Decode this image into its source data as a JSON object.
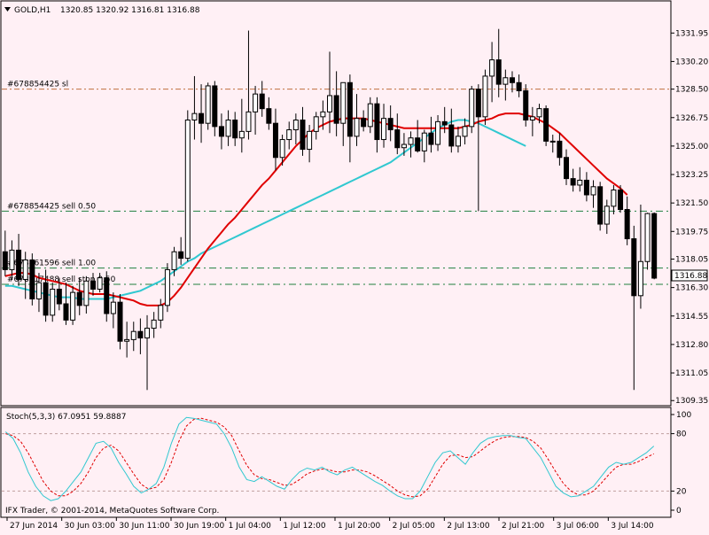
{
  "window": {
    "symbol_label": "GOLD,H1",
    "ohlc_label": "1320.85 1320.92 1316.81 1316.88",
    "copyright": "IFX Trader, © 2001-2014, MetaQuotes Software Corp."
  },
  "colors": {
    "background": "#fff0f5",
    "bull_body": "#ffffff",
    "bear_body": "#000000",
    "ma_fast": "#e00000",
    "ma_slow": "#30c8d0",
    "sl_line": "#c07040",
    "order_line": "#208040",
    "stoch_main": "#30c8d0",
    "stoch_signal": "#e00000",
    "stoch_level": "#c0a0a0"
  },
  "chart_data": [
    {
      "type": "candlestick",
      "title": "GOLD,H1",
      "ylim": [
        1309.2,
        1333.0
      ],
      "y_ticks": [
        "1331.95",
        "1330.20",
        "1328.50",
        "1326.75",
        "1325.00",
        "1323.25",
        "1321.50",
        "1319.75",
        "1318.05",
        "1316.30",
        "1314.55",
        "1312.80",
        "1311.05",
        "1309.35"
      ],
      "x_ticks": [
        "27 Jun 2014",
        "30 Jun 03:00",
        "30 Jun 11:00",
        "30 Jun 19:00",
        "1 Jul 04:00",
        "1 Jul 12:00",
        "1 Jul 20:00",
        "2 Jul 05:00",
        "2 Jul 13:00",
        "2 Jul 21:00",
        "3 Jul 06:00",
        "3 Jul 14:00"
      ],
      "current_price": "1316.88",
      "ohlc": [
        [
          1318.5,
          1319.8,
          1317.0,
          1317.4
        ],
        [
          1317.4,
          1319.2,
          1316.8,
          1318.6
        ],
        [
          1318.6,
          1319.6,
          1316.4,
          1316.8
        ],
        [
          1316.8,
          1318.5,
          1315.6,
          1318.0
        ],
        [
          1318.0,
          1318.4,
          1315.2,
          1315.6
        ],
        [
          1315.6,
          1317.2,
          1314.8,
          1316.6
        ],
        [
          1316.6,
          1317.4,
          1314.2,
          1314.6
        ],
        [
          1314.6,
          1316.6,
          1314.2,
          1316.2
        ],
        [
          1316.2,
          1316.9,
          1314.9,
          1315.3
        ],
        [
          1315.3,
          1316.6,
          1314.0,
          1314.3
        ],
        [
          1314.3,
          1316.4,
          1314.0,
          1316.0
        ],
        [
          1316.0,
          1316.9,
          1314.6,
          1315.2
        ],
        [
          1315.2,
          1317.0,
          1314.7,
          1316.7
        ],
        [
          1316.7,
          1317.2,
          1315.8,
          1316.2
        ],
        [
          1316.2,
          1317.2,
          1316.0,
          1316.9
        ],
        [
          1316.9,
          1317.3,
          1314.2,
          1314.7
        ],
        [
          1314.7,
          1316.0,
          1313.8,
          1315.4
        ],
        [
          1315.4,
          1315.9,
          1312.5,
          1313.0
        ],
        [
          1313.0,
          1314.2,
          1312.0,
          1313.1
        ],
        [
          1313.1,
          1314.2,
          1312.4,
          1313.6
        ],
        [
          1313.6,
          1314.4,
          1312.2,
          1313.2
        ],
        [
          1313.2,
          1314.6,
          1310.0,
          1313.8
        ],
        [
          1313.8,
          1314.8,
          1313.2,
          1314.3
        ],
        [
          1314.3,
          1315.6,
          1313.8,
          1315.2
        ],
        [
          1315.2,
          1317.8,
          1314.8,
          1317.4
        ],
        [
          1317.4,
          1318.8,
          1317.0,
          1318.5
        ],
        [
          1318.5,
          1319.4,
          1317.7,
          1318.1
        ],
        [
          1318.1,
          1327.2,
          1317.9,
          1326.6
        ],
        [
          1326.6,
          1329.3,
          1325.4,
          1327.0
        ],
        [
          1327.0,
          1328.8,
          1325.2,
          1326.4
        ],
        [
          1326.4,
          1328.9,
          1326.0,
          1328.7
        ],
        [
          1328.7,
          1329.0,
          1325.6,
          1326.2
        ],
        [
          1326.2,
          1327.0,
          1324.8,
          1325.6
        ],
        [
          1325.6,
          1327.2,
          1325.0,
          1326.6
        ],
        [
          1326.6,
          1327.1,
          1325.0,
          1325.5
        ],
        [
          1325.5,
          1327.9,
          1324.6,
          1325.9
        ],
        [
          1325.9,
          1332.1,
          1325.4,
          1327.1
        ],
        [
          1327.1,
          1328.7,
          1325.7,
          1328.2
        ],
        [
          1328.2,
          1329.0,
          1326.8,
          1327.3
        ],
        [
          1327.3,
          1328.0,
          1326.0,
          1326.4
        ],
        [
          1326.4,
          1327.3,
          1323.5,
          1324.3
        ],
        [
          1324.3,
          1325.7,
          1323.8,
          1325.4
        ],
        [
          1325.4,
          1326.5,
          1324.8,
          1326.0
        ],
        [
          1326.0,
          1327.0,
          1325.1,
          1326.6
        ],
        [
          1326.6,
          1327.4,
          1324.4,
          1324.8
        ],
        [
          1324.8,
          1326.3,
          1324.0,
          1325.9
        ],
        [
          1325.9,
          1327.1,
          1325.4,
          1326.8
        ],
        [
          1326.8,
          1327.8,
          1326.0,
          1327.1
        ],
        [
          1327.1,
          1330.8,
          1325.8,
          1328.1
        ],
        [
          1328.1,
          1329.6,
          1325.6,
          1326.4
        ],
        [
          1326.4,
          1328.8,
          1325.0,
          1328.9
        ],
        [
          1328.9,
          1329.4,
          1324.0,
          1325.6
        ],
        [
          1325.6,
          1328.2,
          1325.0,
          1326.7
        ],
        [
          1326.7,
          1327.2,
          1325.9,
          1326.2
        ],
        [
          1326.2,
          1328.0,
          1325.8,
          1327.6
        ],
        [
          1327.6,
          1328.0,
          1324.6,
          1325.4
        ],
        [
          1325.4,
          1327.6,
          1324.9,
          1326.7
        ],
        [
          1326.7,
          1327.5,
          1325.3,
          1326.0
        ],
        [
          1326.0,
          1327.0,
          1324.5,
          1324.9
        ],
        [
          1324.9,
          1325.8,
          1324.4,
          1325.1
        ],
        [
          1325.1,
          1325.9,
          1324.3,
          1325.5
        ],
        [
          1325.5,
          1326.6,
          1324.6,
          1324.7
        ],
        [
          1324.7,
          1326.0,
          1324.0,
          1325.8
        ],
        [
          1325.8,
          1326.8,
          1324.6,
          1325.1
        ],
        [
          1325.1,
          1326.9,
          1324.7,
          1326.5
        ],
        [
          1326.5,
          1327.4,
          1325.8,
          1326.3
        ],
        [
          1326.3,
          1327.3,
          1324.6,
          1325.0
        ],
        [
          1325.0,
          1326.2,
          1324.6,
          1325.6
        ],
        [
          1325.6,
          1326.7,
          1325.1,
          1326.2
        ],
        [
          1326.2,
          1328.7,
          1325.8,
          1328.5
        ],
        [
          1328.5,
          1328.8,
          1321.0,
          1326.8
        ],
        [
          1326.8,
          1329.7,
          1326.3,
          1329.3
        ],
        [
          1329.3,
          1331.4,
          1327.7,
          1330.3
        ],
        [
          1330.3,
          1332.2,
          1328.0,
          1328.8
        ],
        [
          1328.8,
          1329.7,
          1327.8,
          1329.2
        ],
        [
          1329.2,
          1329.6,
          1328.3,
          1328.9
        ],
        [
          1328.9,
          1329.4,
          1328.0,
          1328.4
        ],
        [
          1328.4,
          1328.8,
          1326.2,
          1326.6
        ],
        [
          1326.6,
          1327.4,
          1325.6,
          1326.8
        ],
        [
          1326.8,
          1327.6,
          1326.4,
          1327.3
        ],
        [
          1327.3,
          1327.5,
          1325.0,
          1325.3
        ],
        [
          1325.3,
          1325.7,
          1324.6,
          1325.3
        ],
        [
          1325.3,
          1325.8,
          1323.8,
          1324.3
        ],
        [
          1324.3,
          1324.8,
          1322.6,
          1323.0
        ],
        [
          1323.0,
          1323.6,
          1322.2,
          1322.6
        ],
        [
          1322.6,
          1323.7,
          1322.2,
          1322.9
        ],
        [
          1322.9,
          1323.4,
          1321.6,
          1322.0
        ],
        [
          1322.0,
          1322.9,
          1321.2,
          1322.5
        ],
        [
          1322.5,
          1322.8,
          1319.8,
          1320.2
        ],
        [
          1320.2,
          1321.7,
          1319.6,
          1321.3
        ],
        [
          1321.3,
          1322.6,
          1320.8,
          1322.3
        ],
        [
          1322.3,
          1322.6,
          1320.9,
          1321.1
        ],
        [
          1321.1,
          1321.9,
          1318.9,
          1319.3
        ],
        [
          1319.3,
          1320.1,
          1310.0,
          1315.8
        ],
        [
          1315.8,
          1321.4,
          1315.0,
          1317.9
        ],
        [
          1317.9,
          1320.9,
          1317.4,
          1320.85
        ],
        [
          1320.85,
          1320.92,
          1316.81,
          1316.88
        ]
      ],
      "orders": [
        {
          "label": "#678854425 sl",
          "price": 1328.5
        },
        {
          "label": "#678854425 sell 0.50",
          "price": 1321.0
        },
        {
          "label": "#678861596 sell 1.00",
          "price": 1317.5
        },
        {
          "label": "#678917488 sell stop 0.50",
          "price": 1316.5
        }
      ],
      "ma_fast": [
        1317.0,
        1317.1,
        1317.2,
        1317.2,
        1317.1,
        1316.9,
        1316.8,
        1316.7,
        1316.6,
        1316.5,
        1316.3,
        1316.1,
        1316.0,
        1315.9,
        1315.9,
        1315.9,
        1315.8,
        1315.7,
        1315.6,
        1315.5,
        1315.3,
        1315.2,
        1315.2,
        1315.2,
        1315.4,
        1315.8,
        1316.3,
        1316.9,
        1317.5,
        1318.1,
        1318.7,
        1319.2,
        1319.7,
        1320.2,
        1320.6,
        1321.1,
        1321.6,
        1322.1,
        1322.6,
        1323.0,
        1323.5,
        1324.0,
        1324.5,
        1325.0,
        1325.4,
        1325.8,
        1326.1,
        1326.3,
        1326.5,
        1326.6,
        1326.7,
        1326.7,
        1326.7,
        1326.7,
        1326.6,
        1326.5,
        1326.4,
        1326.3,
        1326.2,
        1326.1,
        1326.1,
        1326.1,
        1326.1,
        1326.1,
        1326.1,
        1326.1,
        1326.1,
        1326.1,
        1326.2,
        1326.3,
        1326.5,
        1326.6,
        1326.7,
        1326.9,
        1327.0,
        1327.0,
        1327.0,
        1326.9,
        1326.8,
        1326.6,
        1326.4,
        1326.1,
        1325.8,
        1325.4,
        1325.0,
        1324.6,
        1324.2,
        1323.8,
        1323.4,
        1323.0,
        1322.7,
        1322.4,
        1322.0
      ],
      "ma_slow": [
        1316.4,
        1316.4,
        1316.3,
        1316.2,
        1316.1,
        1316.0,
        1315.9,
        1315.8,
        1315.7,
        1315.7,
        1315.7,
        1315.6,
        1315.6,
        1315.6,
        1315.6,
        1315.6,
        1315.7,
        1315.8,
        1315.9,
        1316.0,
        1316.1,
        1316.3,
        1316.5,
        1316.7,
        1317.0,
        1317.3,
        1317.6,
        1317.9,
        1318.1,
        1318.4,
        1318.6,
        1318.8,
        1319.0,
        1319.2,
        1319.4,
        1319.6,
        1319.8,
        1320.0,
        1320.2,
        1320.4,
        1320.6,
        1320.8,
        1321.0,
        1321.2,
        1321.4,
        1321.6,
        1321.8,
        1322.0,
        1322.2,
        1322.4,
        1322.6,
        1322.8,
        1323.0,
        1323.2,
        1323.4,
        1323.6,
        1323.8,
        1324.0,
        1324.3,
        1324.6,
        1324.9,
        1325.2,
        1325.5,
        1325.8,
        1326.1,
        1326.3,
        1326.5,
        1326.6,
        1326.6,
        1326.5,
        1326.4,
        1326.2,
        1326.0,
        1325.8,
        1325.6,
        1325.4,
        1325.2,
        1325.0
      ],
      "ma_slow_start": 0
    },
    {
      "type": "line",
      "title": "Stoch(5,3,3)",
      "readout": "Stoch(5,3,3) 67.0951 59.8887",
      "ylim": [
        0,
        100
      ],
      "y_ticks": [
        "100",
        "80",
        "20",
        "0"
      ],
      "levels": [
        80,
        20
      ],
      "main": [
        82,
        75,
        60,
        40,
        25,
        15,
        10,
        12,
        20,
        30,
        40,
        55,
        70,
        72,
        65,
        50,
        38,
        25,
        18,
        22,
        28,
        45,
        70,
        90,
        97,
        96,
        94,
        92,
        90,
        80,
        65,
        45,
        32,
        30,
        35,
        30,
        25,
        22,
        32,
        40,
        44,
        42,
        45,
        40,
        37,
        42,
        45,
        40,
        35,
        30,
        26,
        20,
        15,
        12,
        12,
        20,
        35,
        50,
        60,
        62,
        55,
        48,
        60,
        70,
        75,
        77,
        78,
        78,
        76,
        75,
        65,
        55,
        40,
        25,
        18,
        14,
        15,
        20,
        25,
        35,
        45,
        50,
        48,
        50,
        55,
        60,
        67
      ],
      "signal": [
        80,
        78,
        72,
        60,
        45,
        30,
        20,
        15,
        15,
        20,
        28,
        40,
        55,
        65,
        68,
        62,
        50,
        38,
        27,
        22,
        24,
        32,
        50,
        72,
        88,
        95,
        96,
        94,
        92,
        87,
        78,
        62,
        47,
        37,
        33,
        32,
        29,
        26,
        27,
        32,
        38,
        41,
        43,
        42,
        40,
        40,
        42,
        42,
        40,
        36,
        31,
        26,
        20,
        16,
        14,
        15,
        22,
        35,
        48,
        57,
        58,
        55,
        56,
        62,
        68,
        73,
        76,
        77,
        77,
        76,
        72,
        65,
        53,
        40,
        28,
        20,
        16,
        16,
        20,
        28,
        37,
        45,
        48,
        48,
        51,
        55,
        59
      ]
    }
  ]
}
